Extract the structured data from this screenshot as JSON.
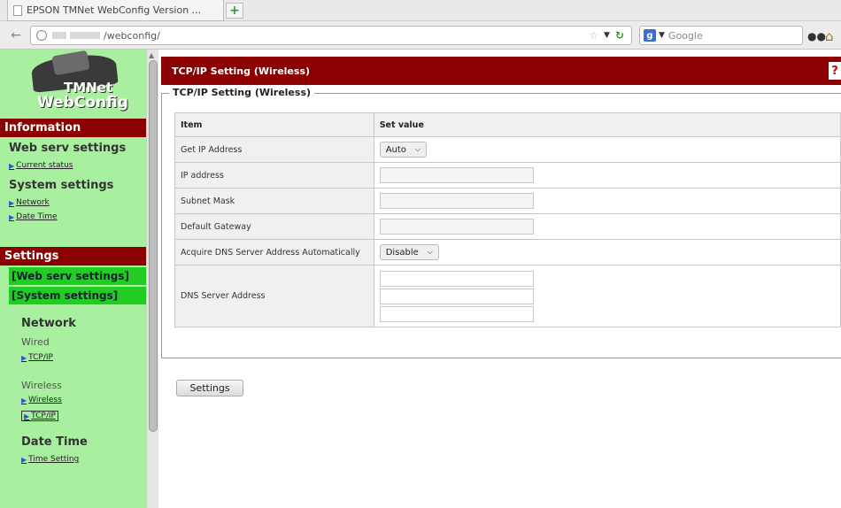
{
  "browser": {
    "tab_title": "EPSON TMNet WebConfig Version ...",
    "new_tab_symbol": "+",
    "url_path": "/webconfig/",
    "search_placeholder": "Google"
  },
  "sidebar": {
    "logo": {
      "line1": "TMNet",
      "line2": "WebConfig"
    },
    "information": {
      "header": "Information",
      "web_serv_heading": "Web serv settings",
      "current_status": "Current status",
      "system_heading": "System settings",
      "network": "Network",
      "date_time": "Date Time"
    },
    "settings": {
      "header": "Settings",
      "web_serv_button": "[Web serv settings]",
      "system_button": "[System settings]",
      "network_heading": "Network",
      "wired_label": "Wired",
      "wired_tcpip": "TCP/IP",
      "wireless_label": "Wireless",
      "wireless_link": "Wireless",
      "wireless_tcpip": "TCP/IP",
      "date_time_heading": "Date Time",
      "time_setting": "Time Setting"
    }
  },
  "main": {
    "title": "TCP/IP Setting (Wireless)",
    "help_symbol": "?",
    "fieldset_legend": "TCP/IP Setting (Wireless)",
    "table": {
      "col_item": "Item",
      "col_value": "Set value",
      "rows": [
        {
          "label": "Get IP Address",
          "value": "Auto"
        },
        {
          "label": "IP address",
          "value": ""
        },
        {
          "label": "Subnet Mask",
          "value": ""
        },
        {
          "label": "Default Gateway",
          "value": ""
        },
        {
          "label": "Acquire DNS Server Address Automatically",
          "value": "Disable"
        },
        {
          "label": "DNS Server Address",
          "value": ""
        }
      ]
    },
    "settings_button": "Settings"
  }
}
